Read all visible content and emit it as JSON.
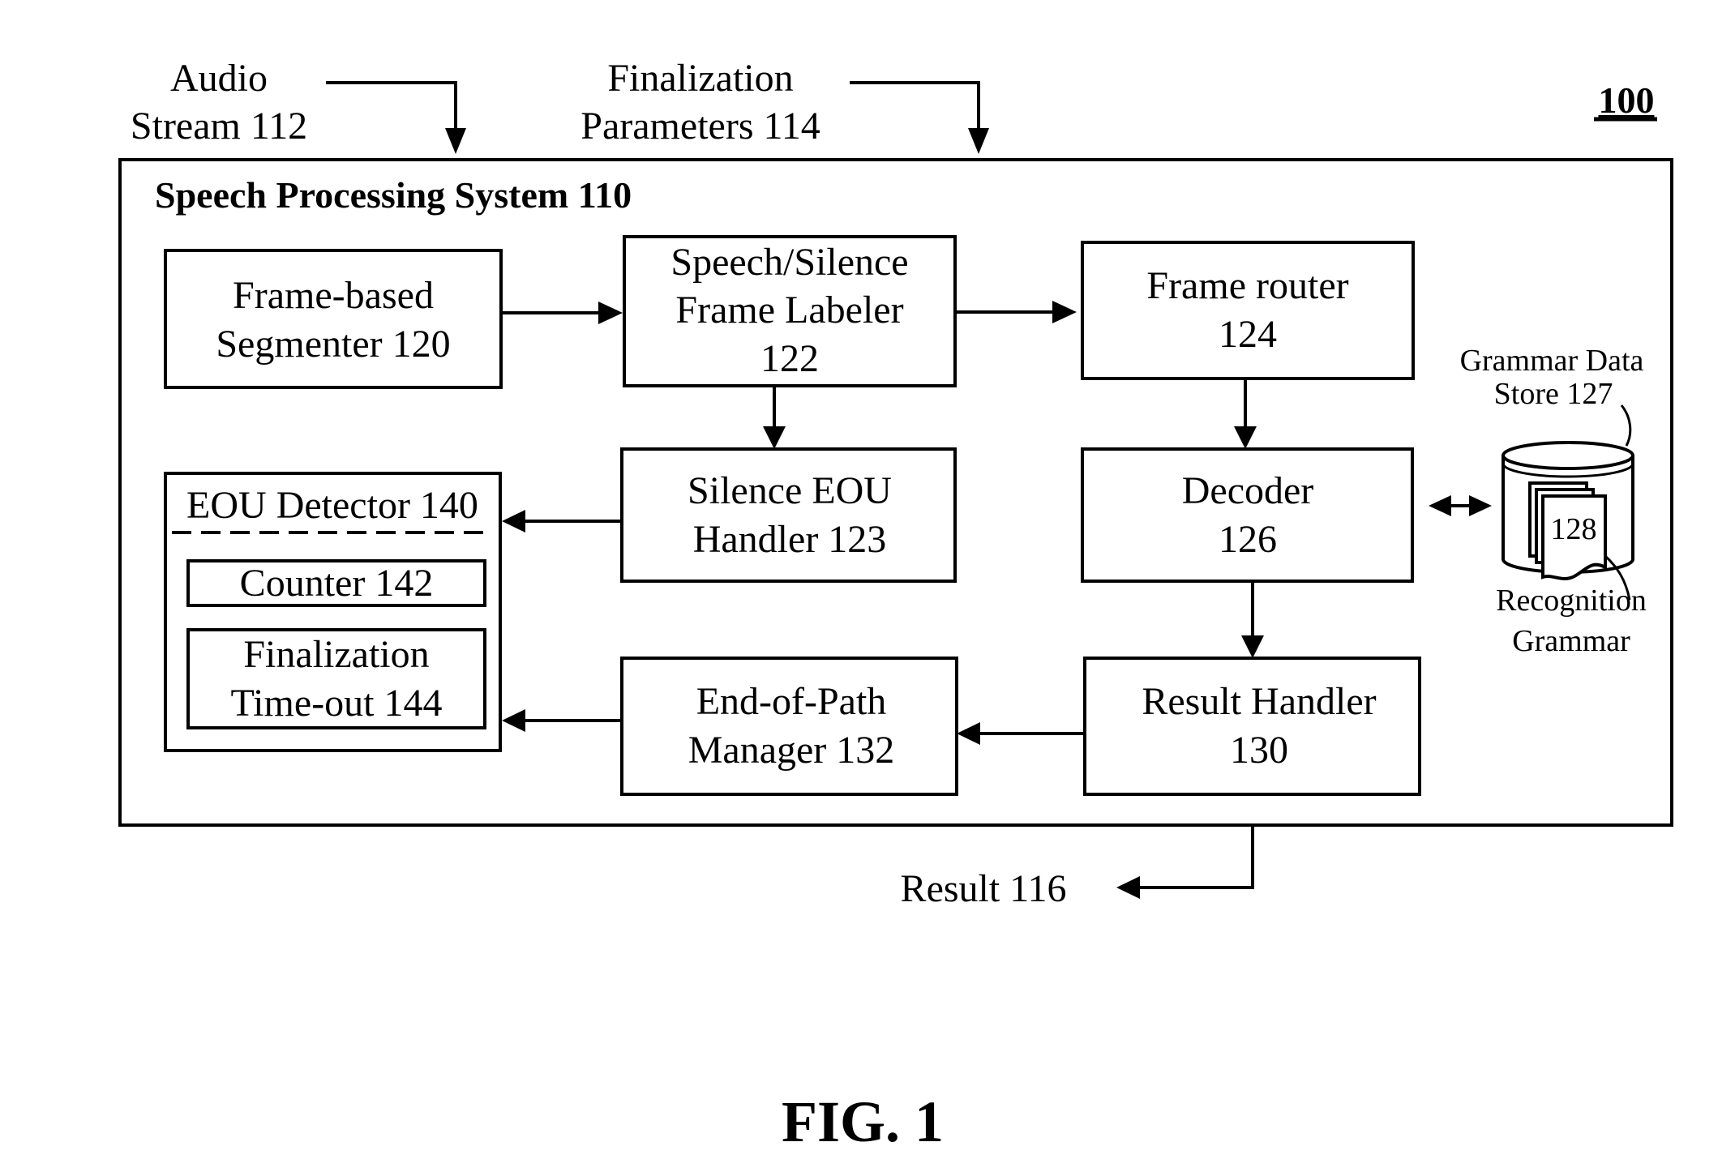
{
  "figure": {
    "reference_number": "100",
    "caption": "FIG. 1"
  },
  "inputs": {
    "audio_stream": {
      "line1": "Audio",
      "line2": "Stream 112"
    },
    "finalization_parameters": {
      "line1": "Finalization",
      "line2": "Parameters 114"
    }
  },
  "system": {
    "title": "Speech Processing System 110"
  },
  "blocks": {
    "segmenter": {
      "line1": "Frame-based",
      "line2": "Segmenter 120"
    },
    "labeler": {
      "line1": "Speech/Silence",
      "line2": "Frame Labeler",
      "line3": "122"
    },
    "router": {
      "line1": "Frame router",
      "line2": "124"
    },
    "silence_handler": {
      "line1": "Silence EOU",
      "line2": "Handler 123"
    },
    "decoder": {
      "line1": "Decoder",
      "line2": "126"
    },
    "eou_detector": {
      "title": "EOU Detector 140",
      "counter": "Counter 142",
      "timeout": {
        "line1": "Finalization",
        "line2": "Time-out 144"
      }
    },
    "end_of_path": {
      "line1": "End-of-Path",
      "line2": "Manager 132"
    },
    "result_handler": {
      "line1": "Result Handler",
      "line2": "130"
    }
  },
  "data_store": {
    "label": {
      "line1": "Grammar Data",
      "line2": "Store 127"
    },
    "grammar_number": "128",
    "grammar_label": {
      "line1": "Recognition",
      "line2": "Grammar"
    }
  },
  "output": {
    "result": "Result 116"
  },
  "connections": [
    {
      "from": "Audio Stream 112",
      "to": "Speech Processing System 110"
    },
    {
      "from": "Finalization Parameters 114",
      "to": "Speech Processing System 110"
    },
    {
      "from": "Frame-based Segmenter 120",
      "to": "Speech/Silence Frame Labeler 122"
    },
    {
      "from": "Speech/Silence Frame Labeler 122",
      "to": "Frame router 124"
    },
    {
      "from": "Speech/Silence Frame Labeler 122",
      "to": "Silence EOU Handler 123"
    },
    {
      "from": "Frame router 124",
      "to": "Decoder 126"
    },
    {
      "from": "Decoder 126",
      "to": "Grammar Data Store 127",
      "bidirectional": true
    },
    {
      "from": "Decoder 126",
      "to": "Result Handler 130"
    },
    {
      "from": "Silence EOU Handler 123",
      "to": "EOU Detector 140"
    },
    {
      "from": "Result Handler 130",
      "to": "End-of-Path Manager 132"
    },
    {
      "from": "End-of-Path Manager 132",
      "to": "EOU Detector 140"
    },
    {
      "from": "Result Handler 130",
      "to": "Result 116"
    }
  ]
}
